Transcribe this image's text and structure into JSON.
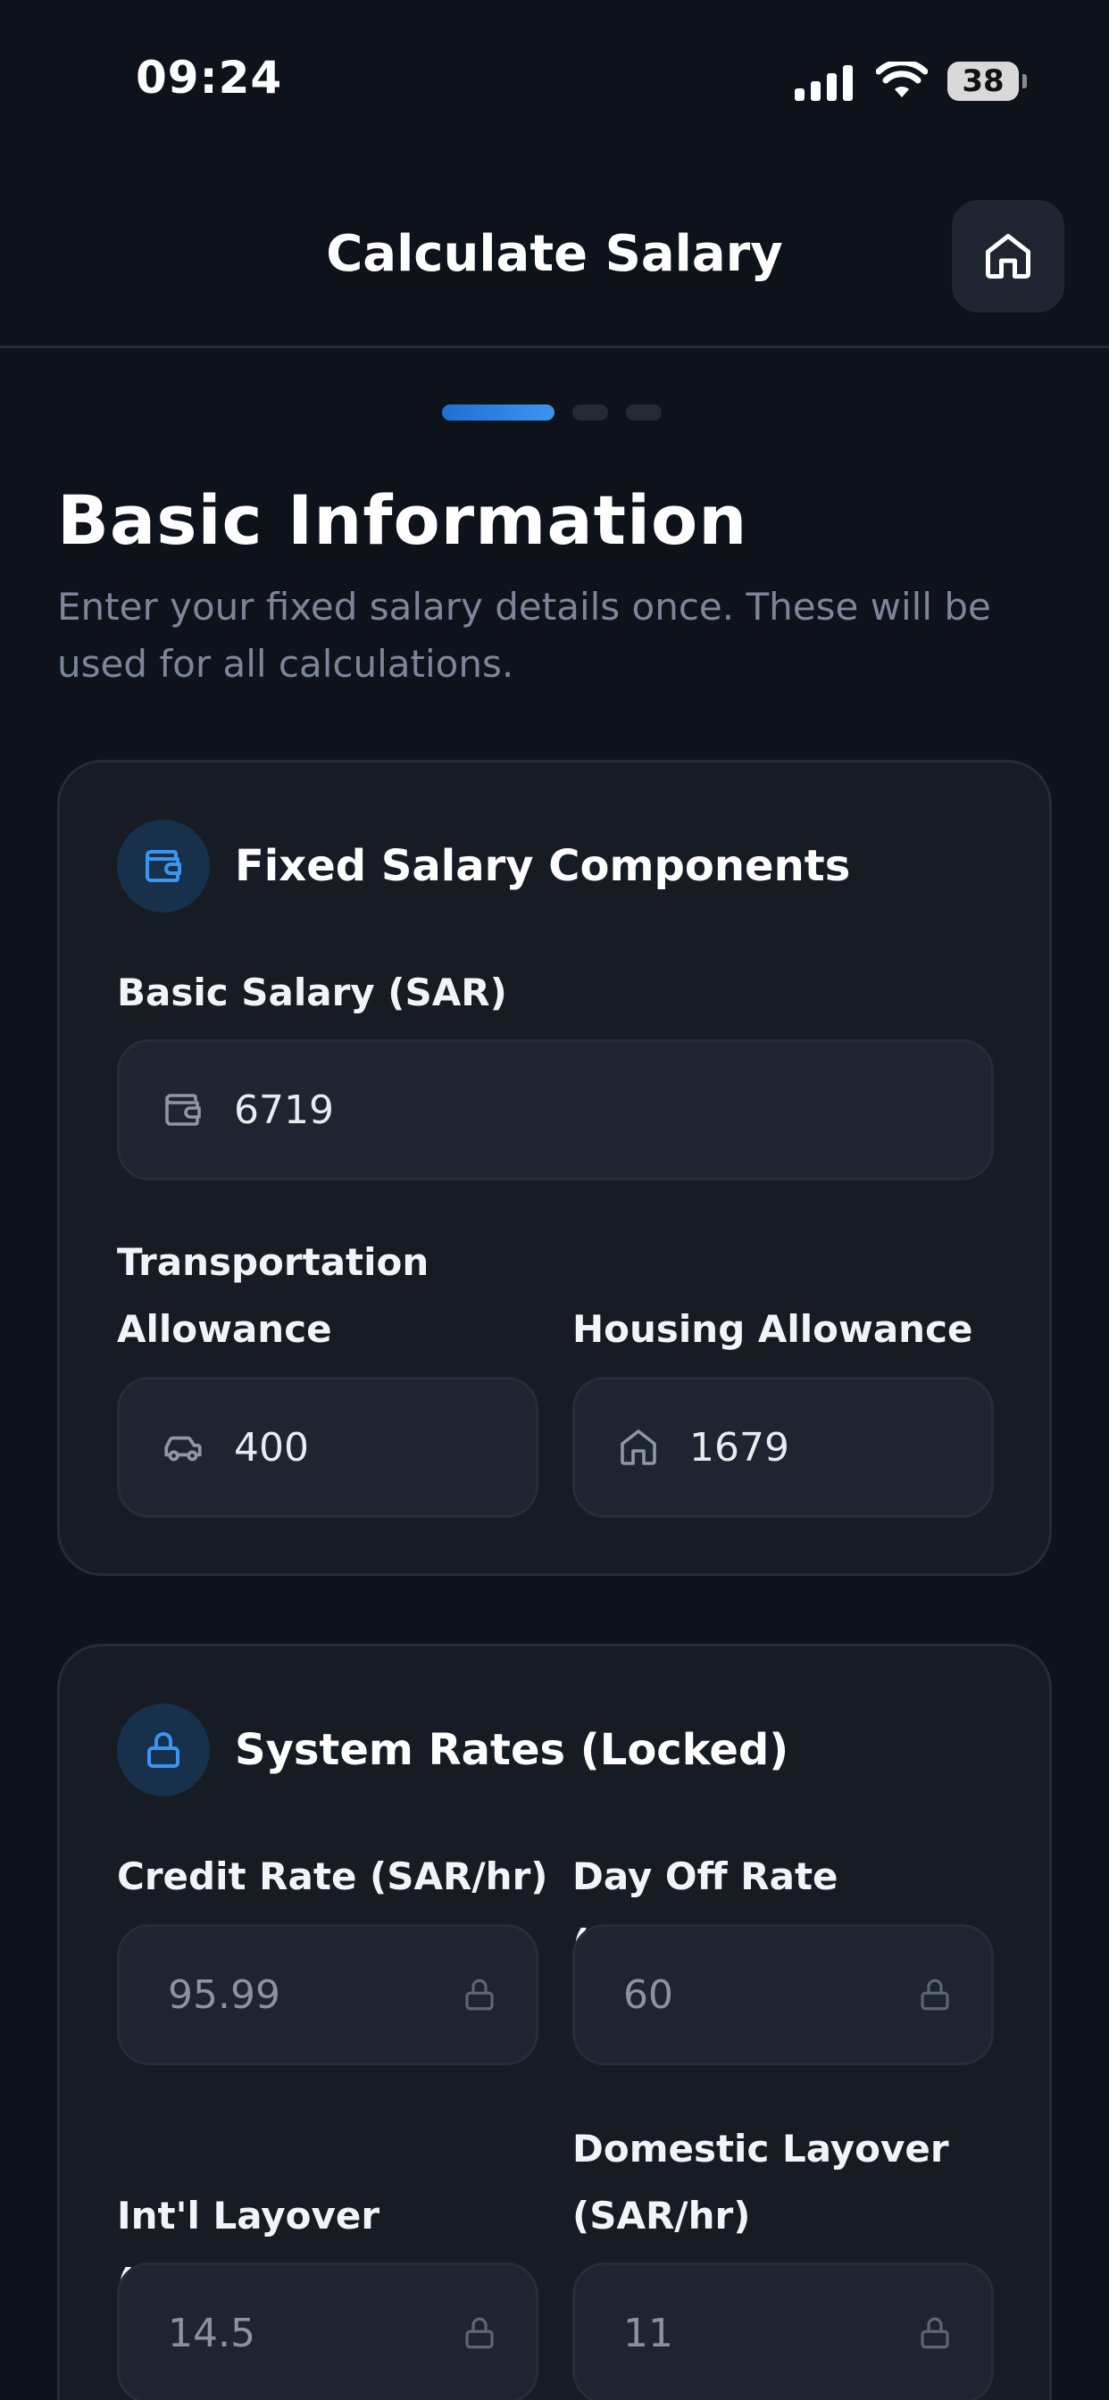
{
  "status_bar": {
    "time": "09:24",
    "battery": "38"
  },
  "header": {
    "title": "Calculate Salary"
  },
  "stepper": {
    "total": 3,
    "current": 1
  },
  "page": {
    "title": "Basic Information",
    "subtitle": "Enter your fixed salary details once. These will be used for all calculations."
  },
  "fixed_card": {
    "title": "Fixed Salary Components",
    "basic_salary": {
      "label": "Basic Salary (SAR)",
      "value": "6719"
    },
    "transport": {
      "label": "Transportation Allowance",
      "value": "400"
    },
    "housing": {
      "label": "Housing Allowance",
      "value": "1679"
    }
  },
  "rates_card": {
    "title": "System Rates (Locked)",
    "credit_rate": {
      "label": "Credit Rate (SAR/hr)",
      "value": "95.99"
    },
    "day_off_rate": {
      "label": "Day Off Rate (SAR/hr)",
      "value": "60"
    },
    "intl_layover": {
      "label": "Int'l Layover (SAR/hr)",
      "value": "14.5"
    },
    "domestic_layover": {
      "label": "Domestic Layover (SAR/hr)",
      "value": "11"
    }
  },
  "colors": {
    "background": "#0e121a",
    "card": "#161b24",
    "input": "#1f2530",
    "accent": "#3b95f0",
    "muted": "#7b8799"
  },
  "icons": [
    "cellular-signal-icon",
    "wifi-icon",
    "battery-icon",
    "home-icon",
    "wallet-icon",
    "car-icon",
    "lock-icon"
  ]
}
